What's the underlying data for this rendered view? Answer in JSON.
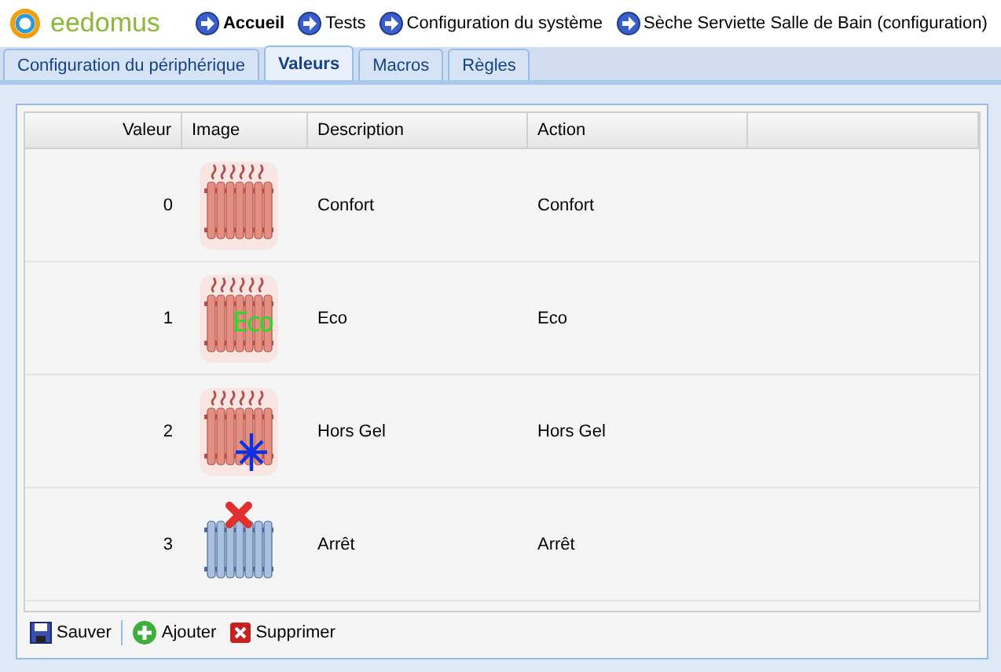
{
  "logo": "eedomus",
  "nav": [
    {
      "label": "Accueil",
      "bold": true
    },
    {
      "label": "Tests",
      "bold": false
    },
    {
      "label": "Configuration du système",
      "bold": false
    },
    {
      "label": "Sèche Serviette Salle de Bain (configuration)",
      "bold": false
    }
  ],
  "tabs": [
    {
      "label": "Configuration du périphérique",
      "selected": false
    },
    {
      "label": "Valeurs",
      "selected": true
    },
    {
      "label": "Macros",
      "selected": false
    },
    {
      "label": "Règles",
      "selected": false
    }
  ],
  "table": {
    "columns": [
      "Valeur",
      "Image",
      "Description",
      "Action"
    ],
    "rows": [
      {
        "value": "0",
        "image": {
          "kind": "hot"
        },
        "description": "Confort",
        "action": "Confort"
      },
      {
        "value": "1",
        "image": {
          "kind": "eco",
          "text": "Eco"
        },
        "description": "Eco",
        "action": "Eco"
      },
      {
        "value": "2",
        "image": {
          "kind": "frost"
        },
        "description": "Hors Gel",
        "action": "Hors Gel"
      },
      {
        "value": "3",
        "image": {
          "kind": "off"
        },
        "description": "Arrêt",
        "action": "Arrêt"
      }
    ]
  },
  "toolbar": [
    {
      "kind": "save",
      "label": "Sauver"
    },
    {
      "kind": "add",
      "label": "Ajouter"
    },
    {
      "kind": "delete",
      "label": "Supprimer"
    }
  ]
}
